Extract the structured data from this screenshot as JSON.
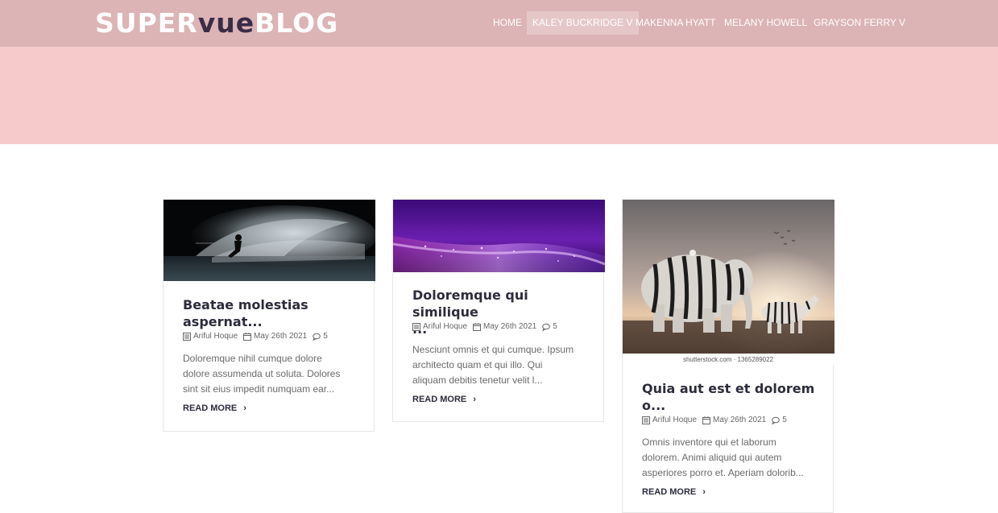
{
  "header": {
    "logo_part1": "SUPER",
    "logo_part2": "vue",
    "logo_part3": "BLOG",
    "nav": [
      {
        "label": "HOME"
      },
      {
        "label": "KALEY BUCKRIDGE V"
      },
      {
        "label": "MAKENNA HYATT"
      },
      {
        "label": "MELANY HOWELL"
      },
      {
        "label": "GRAYSON FERRY V"
      }
    ]
  },
  "posts": [
    {
      "image": "water-skier-photo",
      "title_l1": "Beatae molestias",
      "title_l2": "aspernat...",
      "author": "Ariful Hoque",
      "date": "May 26th 2021",
      "comments": "5",
      "excerpt_l1": "Doloremque nihil cumque dolore",
      "excerpt_l2": "dolore assumenda ut soluta. Dolores",
      "excerpt_l3": "sint sit eius impedit numquam ear...",
      "read_more": "READ MORE"
    },
    {
      "image": "purple-glitter-photo",
      "title_l1": "Doloremque qui similique",
      "title_l2": "...",
      "author": "Ariful Hoque",
      "date": "May 26th 2021",
      "comments": "5",
      "excerpt_l1": "Nesciunt omnis et qui cumque. Ipsum",
      "excerpt_l2": "architecto quam et qui illo. Qui",
      "excerpt_l3": "aliquam debitis tenetur velit l...",
      "read_more": "READ MORE"
    },
    {
      "image": "zebra-elephant-photo",
      "image_caption": "shutterstock.com · 1365289022",
      "title_l1": "Quia aut est et dolorem",
      "title_l2": "o...",
      "author": "Ariful Hoque",
      "date": "May 26th 2021",
      "comments": "5",
      "excerpt_l1": "Omnis inventore qui et laborum",
      "excerpt_l2": "dolorem. Animi aliquid qui autem",
      "excerpt_l3": "asperiores porro et. Aperiam dolorib...",
      "read_more": "READ MORE"
    }
  ],
  "colors": {
    "header_bg": "#dcb4b5",
    "hero_bg": "#f6cacb",
    "logo_accent": "#3a2c47",
    "title_text": "#2c2c3c"
  },
  "icons": [
    "list-icon",
    "calendar-icon",
    "comment-icon",
    "chevron-right-icon"
  ]
}
